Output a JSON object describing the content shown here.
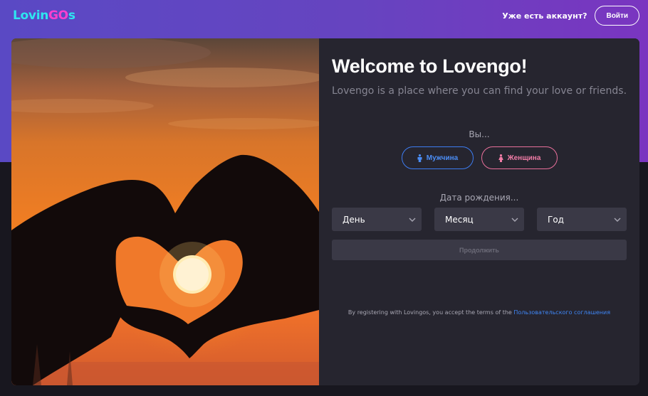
{
  "header": {
    "logo": {
      "part1": "Lovin",
      "part2": "GO",
      "part3": "s"
    },
    "have_account": "Уже есть аккаунт?",
    "login_label": "Войти"
  },
  "form": {
    "title": "Welcome to Lovengo!",
    "subtitle": "Lovengo is a place where you can find your love or friends.",
    "gender_prompt": "Вы...",
    "male_label": "Мужчина",
    "female_label": "Женщина",
    "dob_label": "Дата рождения...",
    "day": "День",
    "month": "Месяц",
    "year": "Год",
    "continue_label": "Продолжить",
    "terms_text": "By registering with Lovingos, you accept the terms of the",
    "terms_link": "Пользовательского соглашения"
  },
  "colors": {
    "brand_gradient_start": "#5a49c4",
    "brand_gradient_end": "#7a35c0",
    "logo_cyan": "#2ee6f0",
    "logo_pink": "#ff3fcf",
    "male_blue": "#3d7cf1",
    "female_pink": "#e9709b",
    "card_bg": "#26252f",
    "link_blue": "#3f86f5"
  },
  "icons": {
    "male": "male-person-icon",
    "female": "female-person-icon",
    "dropdown": "chevron-down-icon"
  }
}
